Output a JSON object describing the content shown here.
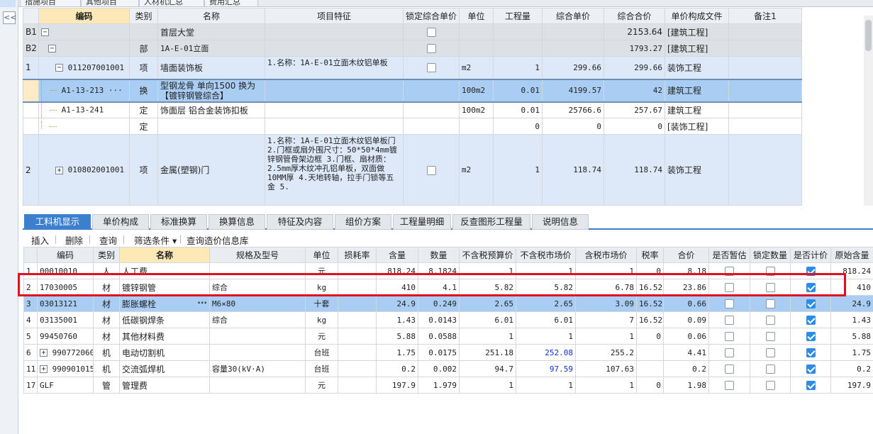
{
  "left_panel": {
    "collapse_label": "<<"
  },
  "top_tabs": [
    "措施项目",
    "其他项目",
    "人材机汇总",
    "费用汇总"
  ],
  "upper_grid": {
    "headers": [
      "编码",
      "类别",
      "名称",
      "项目特征",
      "锁定综合单价",
      "单位",
      "工程量",
      "综合单价",
      "综合合价",
      "单价构成文件",
      "备注1"
    ],
    "rows": [
      {
        "seq": "B1",
        "code": "",
        "type": "",
        "name": "首层大堂",
        "feature": "",
        "unit": "",
        "qty": "",
        "price": "",
        "total": "2153.64",
        "file": "[建筑工程]",
        "note": ""
      },
      {
        "seq": "B2",
        "code": "",
        "type": "部",
        "name": "1A-E-01立面",
        "feature": "",
        "unit": "",
        "qty": "",
        "price": "",
        "total": "1793.27",
        "file": "[建筑工程]",
        "note": ""
      },
      {
        "seq": "1",
        "code": "011207001001",
        "type": "项",
        "name": "墙面装饰板",
        "feature": "1.名称：1A-E-01立面木纹铝单板",
        "unit": "m2",
        "qty": "1",
        "price": "299.66",
        "total": "299.66",
        "file": "装饰工程",
        "note": ""
      },
      {
        "seq": "",
        "code": "A1-13-213 ···",
        "type": "换",
        "name": "型钢龙骨 单向1500  换为【镀锌钢管综合】",
        "feature": "",
        "unit": "100m2",
        "qty": "0.01",
        "price": "4199.57",
        "total": "42",
        "file": "建筑工程",
        "note": ""
      },
      {
        "seq": "",
        "code": "A1-13-241",
        "type": "定",
        "name": "饰面层 铝合金装饰扣板",
        "feature": "",
        "unit": "100m2",
        "qty": "0.01",
        "price": "25766.6",
        "total": "257.67",
        "file": "建筑工程",
        "note": ""
      },
      {
        "seq": "",
        "code": "",
        "type": "定",
        "name": "",
        "feature": "",
        "unit": "",
        "qty": "0",
        "price": "0",
        "total": "0",
        "file": "[装饰工程]",
        "note": ""
      },
      {
        "seq": "2",
        "code": "010802001001",
        "type": "项",
        "name": "金属(塑钢)门",
        "feature": "1.名称：1A-E-01立面木纹铝单板门\n2.门框或扇外围尺寸：50*50*4mm镀锌钢管骨架边框\n3.门框、扇材质：2.5mm厚木纹冲孔铝单板，双面做10MM厚\n4.天地转轴，拉手门锁等五金\n5.",
        "unit": "m2",
        "qty": "1",
        "price": "118.74",
        "total": "118.74",
        "file": "装饰工程",
        "note": ""
      }
    ]
  },
  "bottom_tabs": [
    "工料机显示",
    "单价构成",
    "标准换算",
    "换算信息",
    "特征及内容",
    "组价方案",
    "工程量明细",
    "反查图形工程量",
    "说明信息"
  ],
  "toolbar": [
    "插入",
    "删除",
    "查询",
    "筛选条件 ▾",
    "查询造价信息库"
  ],
  "lower_grid": {
    "headers": [
      "",
      "编码",
      "类别",
      "名称",
      "规格及型号",
      "单位",
      "损耗率",
      "含量",
      "数量",
      "不含税预算价",
      "不含税市场价",
      "含税市场价",
      "税率",
      "合价",
      "是否暂估",
      "锁定数量",
      "是否计价",
      "原始含量"
    ],
    "rows": [
      {
        "no": "1",
        "code": "00010010",
        "cat": "人",
        "name": "人工费",
        "spec": "",
        "unit": "元",
        "loss": "",
        "content": "818.24",
        "qty": "8.1824",
        "budget": "1",
        "market": "1",
        "taxmarket": "1",
        "tax": "0",
        "total": "8.18",
        "orig": "818.24",
        "priced": true
      },
      {
        "no": "2",
        "code": "17030005",
        "cat": "材",
        "name": "镀锌钢管",
        "spec": "综合",
        "unit": "kg",
        "loss": "",
        "content": "410",
        "qty": "4.1",
        "budget": "5.82",
        "market": "5.82",
        "taxmarket": "6.78",
        "tax": "16.52",
        "total": "23.86",
        "orig": "410",
        "priced": true
      },
      {
        "no": "3",
        "code": "03013121",
        "cat": "材",
        "name": "膨胀螺栓",
        "spec": "M6×80",
        "unit": "十套",
        "loss": "",
        "content": "24.9",
        "qty": "0.249",
        "budget": "2.65",
        "market": "2.65",
        "taxmarket": "3.09",
        "tax": "16.52",
        "total": "0.66",
        "orig": "24.9",
        "priced": true
      },
      {
        "no": "4",
        "code": "03135001",
        "cat": "材",
        "name": "低碳钢焊条",
        "spec": "综合",
        "unit": "kg",
        "loss": "",
        "content": "1.43",
        "qty": "0.0143",
        "budget": "6.01",
        "market": "6.01",
        "taxmarket": "7",
        "tax": "16.52",
        "total": "0.09",
        "orig": "1.43",
        "priced": true
      },
      {
        "no": "5",
        "code": "99450760",
        "cat": "材",
        "name": "其他材料费",
        "spec": "",
        "unit": "元",
        "loss": "",
        "content": "5.88",
        "qty": "0.0588",
        "budget": "1",
        "market": "1",
        "taxmarket": "1",
        "tax": "0",
        "total": "0.06",
        "orig": "5.88",
        "priced": true
      },
      {
        "no": "6",
        "code": "990772060",
        "cat": "机",
        "name": "电动切割机",
        "spec": "",
        "unit": "台班",
        "loss": "",
        "content": "1.75",
        "qty": "0.0175",
        "budget": "251.18",
        "market": "252.08",
        "taxmarket": "255.2",
        "tax": "",
        "total": "4.41",
        "orig": "1.75",
        "priced": true
      },
      {
        "no": "11",
        "code": "990901015",
        "cat": "机",
        "name": "交流弧焊机",
        "spec": "容量30(kV·A)",
        "unit": "台班",
        "loss": "",
        "content": "0.2",
        "qty": "0.002",
        "budget": "94.7",
        "market": "97.59",
        "taxmarket": "107.63",
        "tax": "",
        "total": "0.2",
        "orig": "0.2",
        "priced": true
      },
      {
        "no": "17",
        "code": "GLF",
        "cat": "管",
        "name": "管理费",
        "spec": "",
        "unit": "元",
        "loss": "",
        "content": "197.9",
        "qty": "1.979",
        "budget": "1",
        "market": "1",
        "taxmarket": "1",
        "tax": "0",
        "total": "1.98",
        "orig": "197.9",
        "priced": true
      }
    ]
  },
  "colors": {
    "accent": "#3d7fcf",
    "highlight_box": "#e01020",
    "market_blue": "#1030d8",
    "selected_row": "#a9cdf3"
  }
}
